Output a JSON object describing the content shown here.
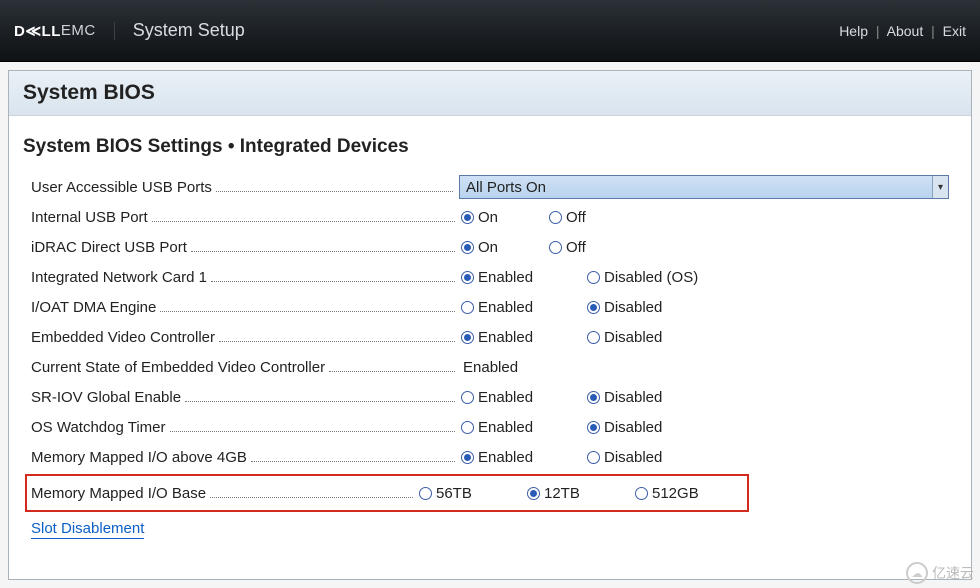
{
  "header": {
    "brand_bold": "D≪LL",
    "brand_thin": "EMC",
    "app_title": "System Setup",
    "links": {
      "help": "Help",
      "about": "About",
      "exit": "Exit"
    },
    "close": "✕"
  },
  "page_title": "System BIOS",
  "breadcrumb": "System BIOS Settings • Integrated Devices",
  "settings": {
    "usb_ports": {
      "label": "User Accessible USB Ports",
      "value": "All Ports On"
    },
    "internal_usb": {
      "label": "Internal USB Port",
      "opts": [
        "On",
        "Off"
      ],
      "selected": "On"
    },
    "idrac_usb": {
      "label": "iDRAC Direct USB Port",
      "opts": [
        "On",
        "Off"
      ],
      "selected": "On"
    },
    "nic1": {
      "label": "Integrated Network Card 1",
      "opts": [
        "Enabled",
        "Disabled (OS)"
      ],
      "selected": "Enabled"
    },
    "ioat": {
      "label": "I/OAT DMA Engine",
      "opts": [
        "Enabled",
        "Disabled"
      ],
      "selected": "Disabled"
    },
    "embedded_video": {
      "label": "Embedded Video Controller",
      "opts": [
        "Enabled",
        "Disabled"
      ],
      "selected": "Enabled"
    },
    "video_state": {
      "label": "Current State of Embedded Video Controller",
      "value": "Enabled"
    },
    "sriov": {
      "label": "SR-IOV Global Enable",
      "opts": [
        "Enabled",
        "Disabled"
      ],
      "selected": "Disabled"
    },
    "watchdog": {
      "label": "OS Watchdog Timer",
      "opts": [
        "Enabled",
        "Disabled"
      ],
      "selected": "Disabled"
    },
    "mmio4gb": {
      "label": "Memory Mapped I/O above 4GB",
      "opts": [
        "Enabled",
        "Disabled"
      ],
      "selected": "Enabled"
    },
    "mmiobase": {
      "label": "Memory Mapped I/O Base",
      "opts": [
        "56TB",
        "12TB",
        "512GB"
      ],
      "selected": "12TB"
    },
    "slot_link": "Slot Disablement"
  },
  "watermark": "亿速云"
}
